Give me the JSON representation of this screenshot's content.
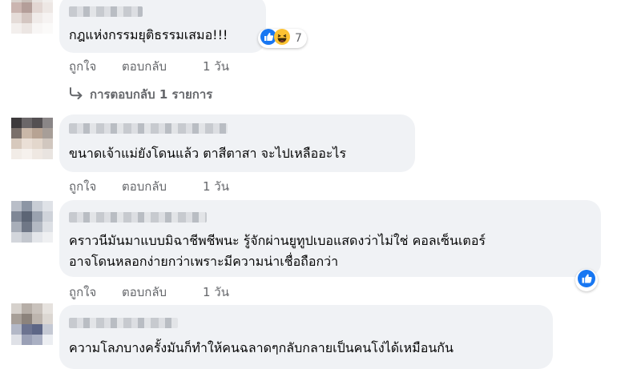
{
  "comments": [
    {
      "text_lines": [
        "กฎแห่งกรรมยุติธรรมเสมอ!!!"
      ],
      "reactions": {
        "icons": [
          "like-icon",
          "haha-icon"
        ],
        "count": "7"
      },
      "actions": {
        "like": "ถูกใจ",
        "reply": "ตอบกลับ",
        "time": "1 วัน"
      },
      "replies_link": "การตอบกลับ 1 รายการ"
    },
    {
      "text_lines": [
        "ขนาดเจ้าแม่ยังโดนแล้ว ตาสีตาสา จะไปเหลืออะไร"
      ],
      "actions": {
        "like": "ถูกใจ",
        "reply": "ตอบกลับ",
        "time": "1 วัน"
      }
    },
    {
      "text_lines": [
        "คราวนีมันมาแบบมิฉาชีพชีพนะ รู้จักผ่านยูทูปเบอแสดงว่าไม่ใช่ คอลเซ็นเตอร์",
        "อาจโดนหลอกง่ายกว่าเพราะมีความน่าเชื่อถือกว่า"
      ],
      "reactions": {
        "icons": [
          "like-icon"
        ]
      },
      "actions": {
        "like": "ถูกใจ",
        "reply": "ตอบกลับ",
        "time": "1 วัน"
      }
    },
    {
      "text_lines": [
        "ความโลภบางครั้งมันก็ทำให้คนฉลาดๆกลับกลายเป็นคนโง่ได้เหมือนกัน"
      ]
    }
  ],
  "colors": {
    "bubble": "#f0f2f5",
    "like_blue": "#1877f2",
    "secondary_text": "#65676b"
  }
}
